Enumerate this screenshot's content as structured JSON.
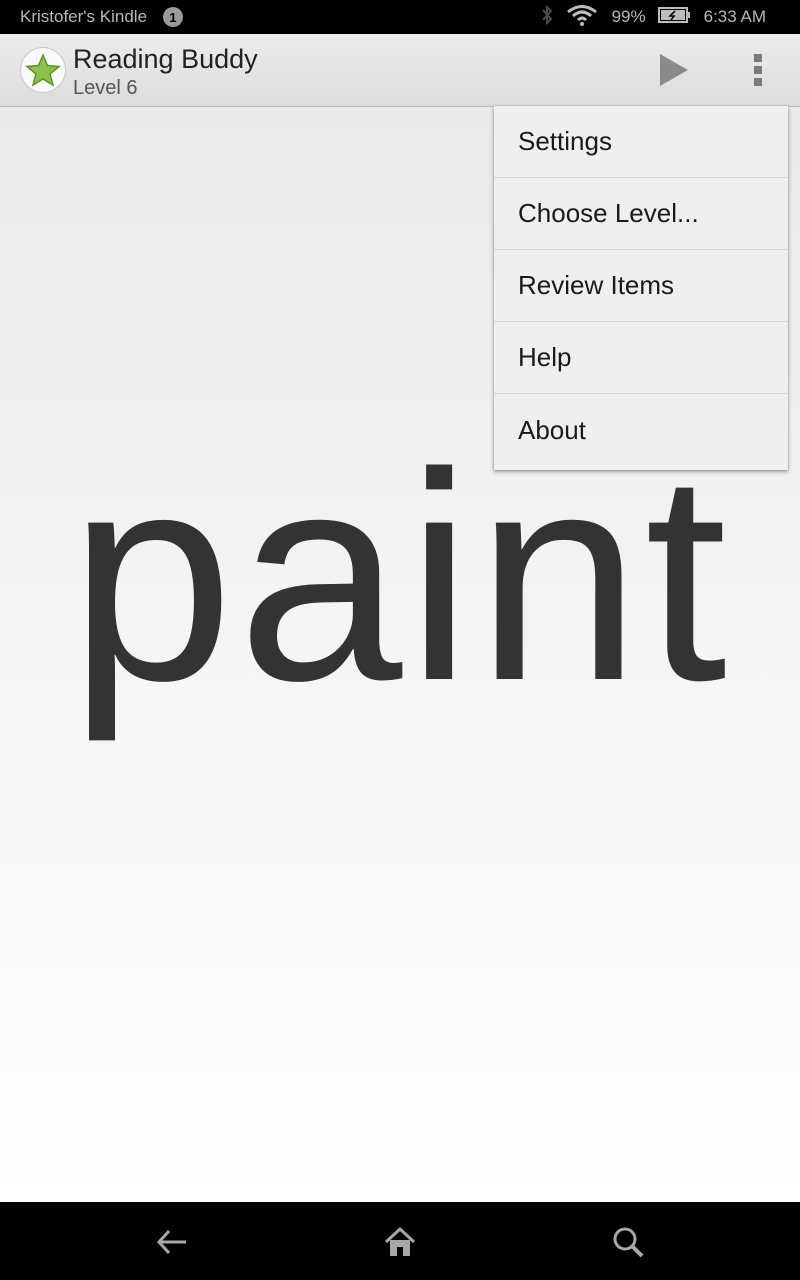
{
  "status_bar": {
    "device_name": "Kristofer's Kindle",
    "notification_count": "1",
    "icons": [
      "bluetooth-icon",
      "wifi-icon",
      "battery-icon"
    ],
    "battery": "99%",
    "time": "6:33 AM"
  },
  "action_bar": {
    "title": "Reading Buddy",
    "subtitle": "Level 6",
    "icons": [
      "star-app-icon",
      "play-icon",
      "overflow-menu-icon"
    ],
    "accent_color": "#7cb342"
  },
  "main": {
    "word": "paint"
  },
  "menu": {
    "items": [
      {
        "label": "Settings"
      },
      {
        "label": "Choose Level..."
      },
      {
        "label": "Review Items"
      },
      {
        "label": "Help"
      },
      {
        "label": "About"
      }
    ]
  },
  "nav_bar": {
    "icons": [
      "back-icon",
      "home-icon",
      "search-icon"
    ]
  }
}
